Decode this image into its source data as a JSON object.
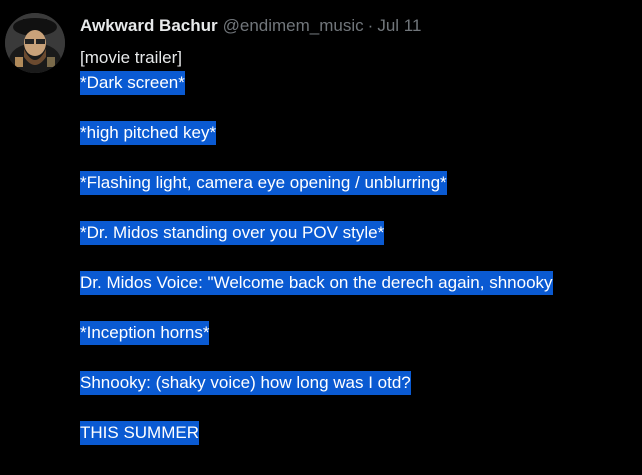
{
  "author": {
    "display_name": "Awkward Bachur",
    "handle": "@endimem_music",
    "separator": "·",
    "date": "Jul 11",
    "avatar_icon": "profile-photo"
  },
  "tweet": {
    "lines": [
      "[movie trailer]",
      "*Dark screen*",
      "*high pitched key*",
      "*Flashing light, camera eye opening / unblurring*",
      "*Dr. Midos standing over you POV style*",
      "Dr. Midos Voice: \"Welcome back on the derech again, shnooky",
      "*Inception horns*",
      "Shnooky: (shaky voice) how long was I otd?",
      "THIS SUMMER"
    ]
  },
  "colors": {
    "background": "#000000",
    "text": "#e7e9ea",
    "muted": "#71767b",
    "selection": "#0a5ad2"
  }
}
